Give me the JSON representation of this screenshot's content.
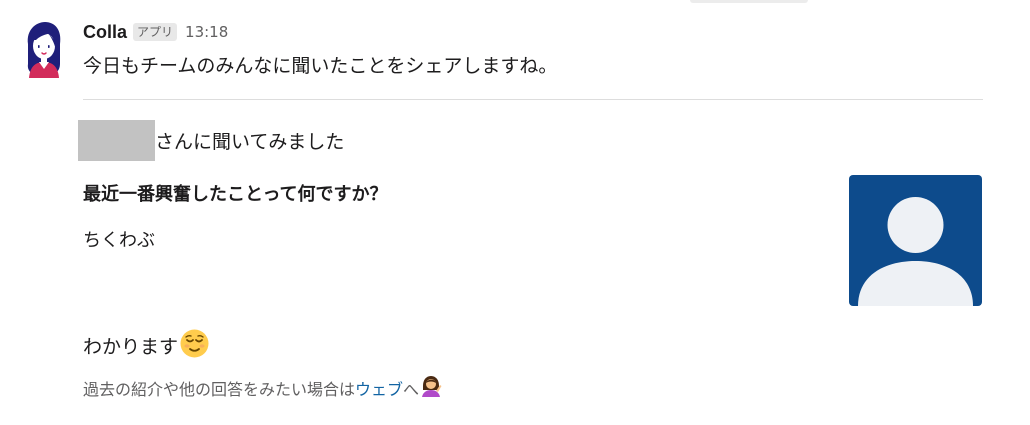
{
  "message": {
    "sender": "Colla",
    "badge": "アプリ",
    "timestamp": "13:18",
    "intro": "今日もチームのみんなに聞いたことをシェアしますね。"
  },
  "post": {
    "asked_suffix": "さんに聞いてみました",
    "question": "最近一番興奮したことって何ですか？",
    "answer": "ちくわぶ",
    "reaction": "わかります",
    "reaction_emoji": "relieved-face-icon"
  },
  "footer": {
    "text_before": "過去の紹介や他の回答をみたい場合は",
    "link": "ウェブ",
    "text_after": "へ",
    "emoji": "person-tipping-hand-icon"
  },
  "colors": {
    "link": "#1264a3",
    "profile_card_bg": "#0d4b8c",
    "muted": "#616061",
    "redaction": "#c2c2c2"
  }
}
